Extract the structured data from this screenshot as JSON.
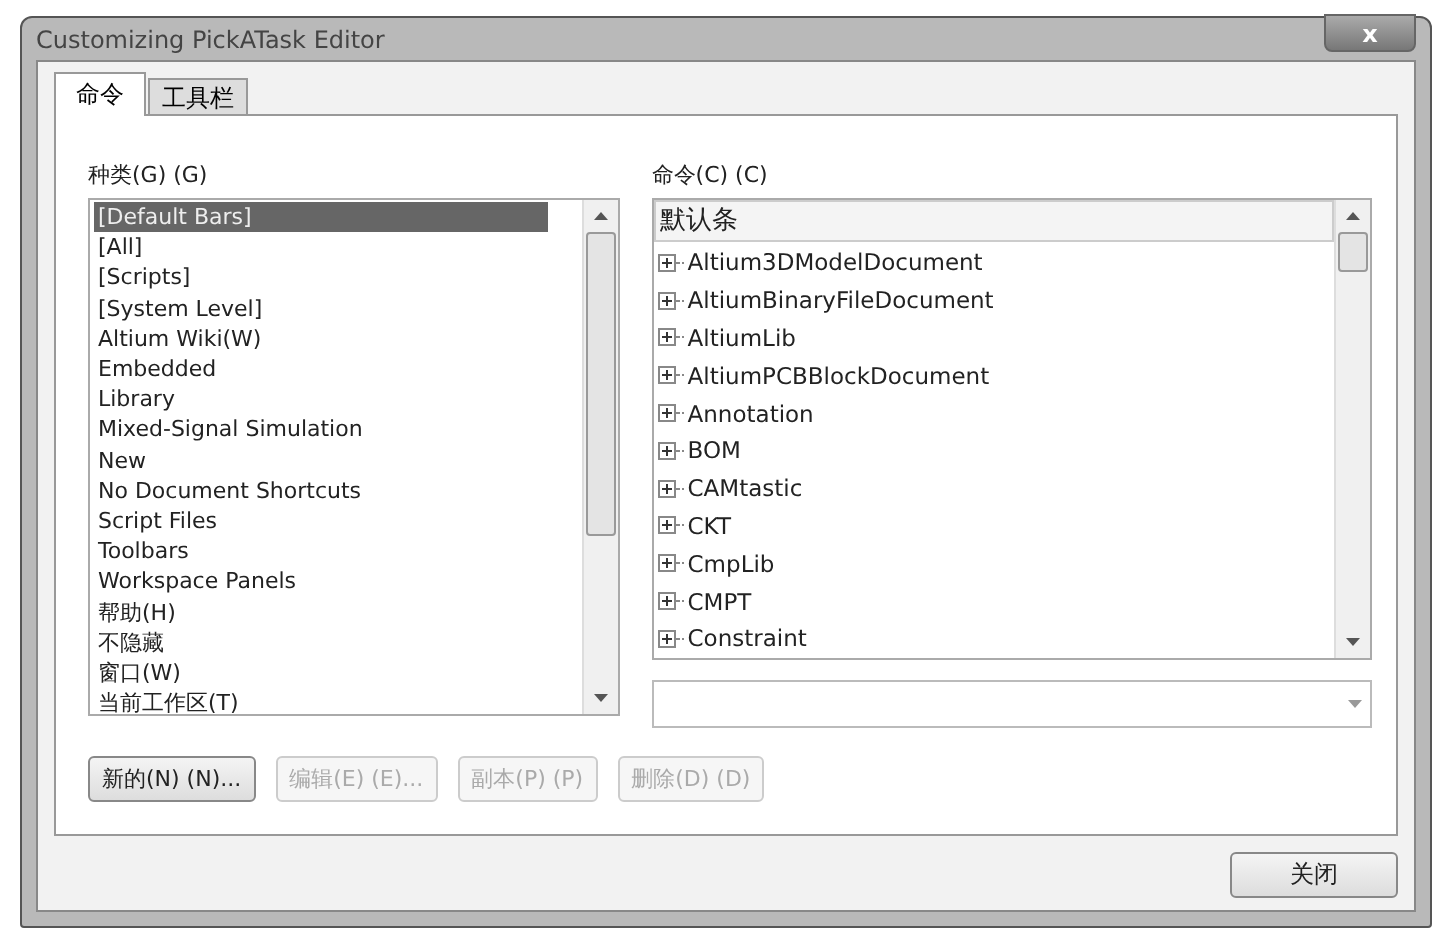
{
  "window": {
    "title": "Customizing PickATask Editor",
    "close_label": "x"
  },
  "tabs": [
    {
      "label": "命令",
      "selected": true
    },
    {
      "label": "工具栏",
      "selected": false
    }
  ],
  "categories": {
    "label": "种类(G) (G)",
    "items": [
      {
        "label": "[Default Bars]",
        "selected": true
      },
      {
        "label": "[All]",
        "selected": false
      },
      {
        "label": "[Scripts]",
        "selected": false
      },
      {
        "label": "[System Level]",
        "selected": false
      },
      {
        "label": "Altium Wiki(W)",
        "selected": false
      },
      {
        "label": "Embedded",
        "selected": false
      },
      {
        "label": "Library",
        "selected": false
      },
      {
        "label": "Mixed-Signal Simulation",
        "selected": false
      },
      {
        "label": "New",
        "selected": false
      },
      {
        "label": "No Document Shortcuts",
        "selected": false
      },
      {
        "label": "Script Files",
        "selected": false
      },
      {
        "label": "Toolbars",
        "selected": false
      },
      {
        "label": "Workspace Panels",
        "selected": false
      },
      {
        "label": "帮助(H)",
        "selected": false
      },
      {
        "label": "不隐藏",
        "selected": false
      },
      {
        "label": "窗口(W)",
        "selected": false
      },
      {
        "label": "当前工作区(T)",
        "selected": false
      }
    ]
  },
  "commands": {
    "label": "命令(C) (C)",
    "header": "默认条",
    "items": [
      {
        "label": "Altium3DModelDocument",
        "expanded": false
      },
      {
        "label": "AltiumBinaryFileDocument",
        "expanded": false
      },
      {
        "label": "AltiumLib",
        "expanded": false
      },
      {
        "label": "AltiumPCBBlockDocument",
        "expanded": false
      },
      {
        "label": "Annotation",
        "expanded": false
      },
      {
        "label": "BOM",
        "expanded": false
      },
      {
        "label": "CAMtastic",
        "expanded": false
      },
      {
        "label": "CKT",
        "expanded": false
      },
      {
        "label": "CmpLib",
        "expanded": false
      },
      {
        "label": "CMPT",
        "expanded": false
      },
      {
        "label": "Constraint",
        "expanded": false
      }
    ]
  },
  "buttons": [
    {
      "label": "新的(N) (N)...",
      "disabled": false
    },
    {
      "label": "编辑(E) (E)...",
      "disabled": true
    },
    {
      "label": "副本(P) (P)",
      "disabled": true
    },
    {
      "label": "删除(D) (D)",
      "disabled": true
    }
  ],
  "close_button": "关闭"
}
